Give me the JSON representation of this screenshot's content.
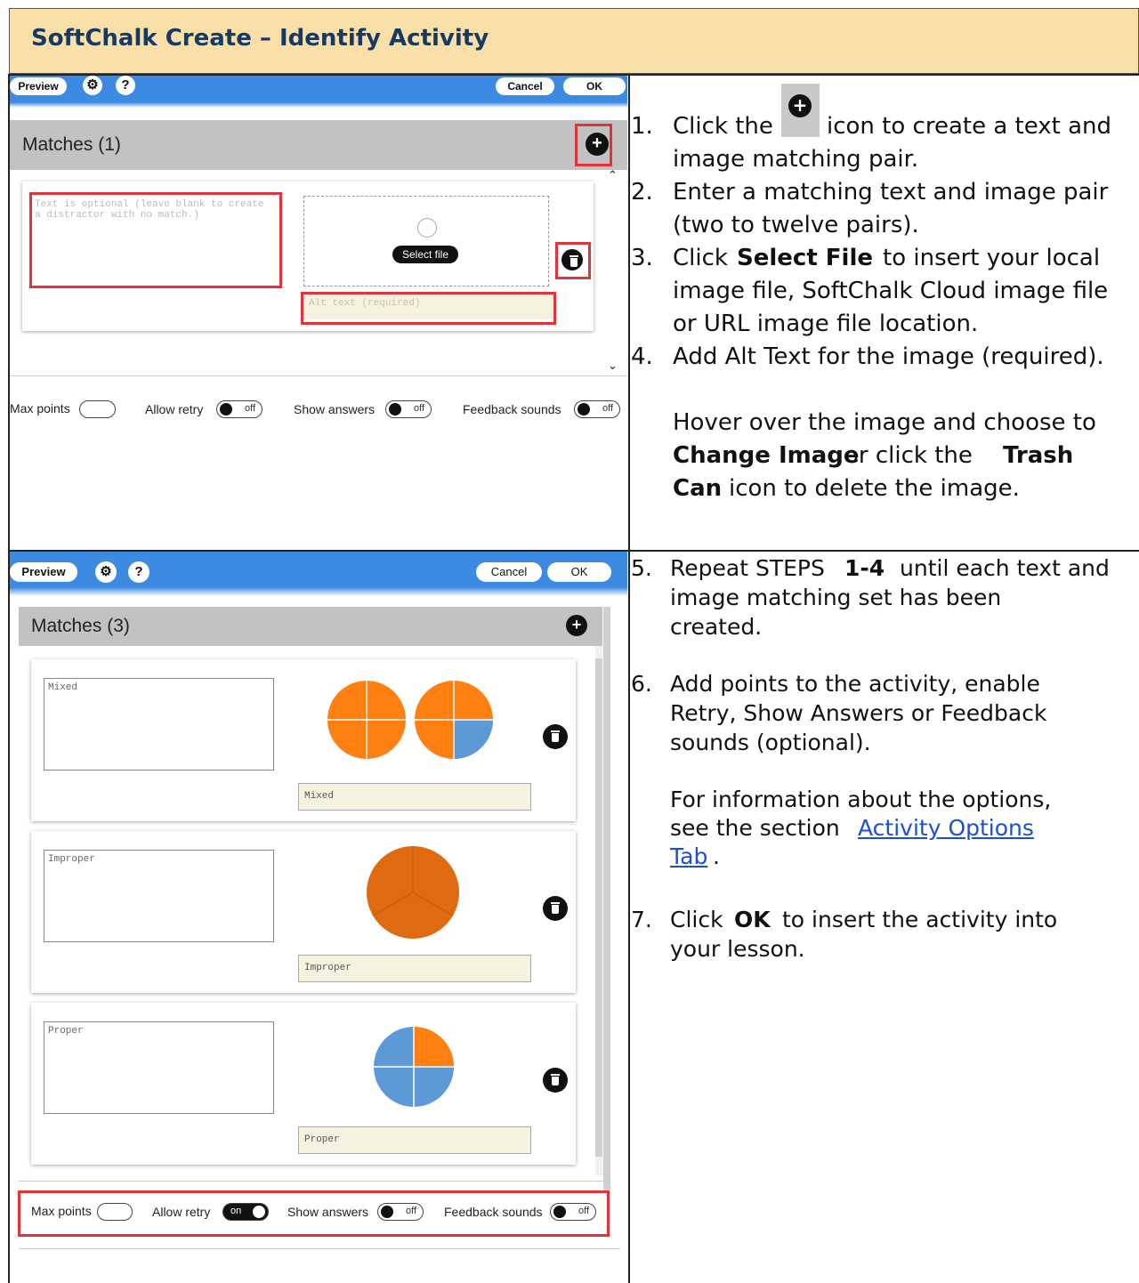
{
  "title": "SoftChalk Create – Identify Activity",
  "toolbar": {
    "preview": "Preview",
    "gear": "gear-icon",
    "help": "?",
    "cancel": "Cancel",
    "ok": "OK"
  },
  "panel1": {
    "matches_label": "Matches (1)",
    "text_placeholder": "Text is optional (leave blank to create a distractor with no match.)",
    "select_file": "Select file",
    "alt_placeholder": "Alt text (required)",
    "options": {
      "max_points": "Max points",
      "allow_retry": "Allow retry",
      "show_answers": "Show answers",
      "feedback_sounds": "Feedback sounds",
      "off": "off"
    }
  },
  "panel2": {
    "matches_label": "Matches (3)",
    "items": [
      {
        "text": "Mixed",
        "alt": "Mixed"
      },
      {
        "text": "Improper",
        "alt": "Improper"
      },
      {
        "text": "Proper",
        "alt": "Proper"
      }
    ],
    "options": {
      "max_points": "Max points",
      "allow_retry": "Allow retry",
      "on": "on",
      "show_answers": "Show answers",
      "feedback_sounds": "Feedback sounds",
      "off": "off"
    }
  },
  "steps_top": {
    "s1_num": "1.",
    "s1_a": "Click the",
    "s1_b": "icon to create a text and",
    "s1_c": "image matching pair.",
    "s2_num": "2.",
    "s2_a": "Enter a matching text and image pair",
    "s2_b": "(two to twelve pairs).",
    "s3_num": "3.",
    "s3_a": "Click",
    "s3_bold": "Select File",
    "s3_b": "to insert your local",
    "s3_c": "image file, SoftChalk Cloud image file",
    "s3_d": "or URL image file location.",
    "s4_num": "4.",
    "s4_a": "Add Alt Text for the image (required).",
    "hover_a": "Hover over the image and choose to",
    "hover_bold1": "Change Image",
    "hover_b": "or click the",
    "hover_bold2": "Trash",
    "hover_bold3": "Can",
    "hover_c": "icon to delete the image."
  },
  "steps_bottom": {
    "s5_num": "5.",
    "s5_a": "Repeat STEPS",
    "s5_bold": "1-4",
    "s5_b": "until each text and",
    "s5_c": "image matching set has been",
    "s5_d": "created.",
    "s6_num": "6.",
    "s6_a": "Add points to the activity, enable",
    "s6_b": "Retry, Show Answers or Feedback",
    "s6_c": "sounds (optional).",
    "info_a": "For information about the options,",
    "info_b": "see the section",
    "info_link1": "Activity Options",
    "info_link2": "Tab",
    "info_end": ".",
    "s7_num": "7.",
    "s7_a": "Click",
    "s7_bold": "OK",
    "s7_b": "to insert the activity into",
    "s7_c": "your lesson."
  },
  "colors": {
    "title_bg": "#fbdfa8",
    "toolbar_blue": "#3d8ae3",
    "pie_orange": "#ff7f11",
    "pie_dark_orange": "#e06a12",
    "pie_blue": "#5b9ad6",
    "highlight_red": "#e0333a"
  }
}
